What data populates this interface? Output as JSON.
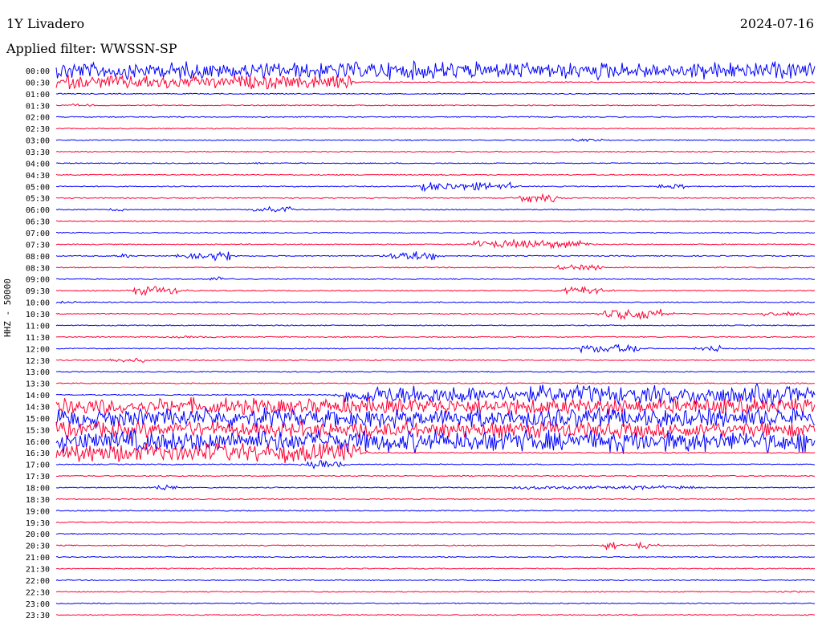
{
  "header": {
    "station": "1Y Livadero",
    "date": "2024-07-16",
    "filter": "Applied filter: WWSSN-SP"
  },
  "chart_data": {
    "type": "line",
    "title": "1Y Livadero",
    "ylabel": "HHZ - 50000",
    "xlabel": "",
    "colors": [
      "#0000ff",
      "#ff0033"
    ],
    "rows": [
      {
        "time": "00:00",
        "activity": [
          [
            0.0,
            1.0,
            0.9
          ]
        ],
        "amp": 14
      },
      {
        "time": "00:30",
        "activity": [
          [
            0.0,
            0.39,
            1.0
          ]
        ],
        "amp": 10
      },
      {
        "time": "01:00",
        "activity": [
          [
            0.78,
            0.81,
            0.5
          ]
        ],
        "amp": 2
      },
      {
        "time": "01:30",
        "activity": [
          [
            0.02,
            0.05,
            1.0
          ]
        ],
        "amp": 2
      },
      {
        "time": "02:00",
        "activity": [],
        "amp": 1
      },
      {
        "time": "02:30",
        "activity": [],
        "amp": 1
      },
      {
        "time": "03:00",
        "activity": [
          [
            0.68,
            0.72,
            1.0
          ]
        ],
        "amp": 2
      },
      {
        "time": "03:30",
        "activity": [],
        "amp": 1
      },
      {
        "time": "04:00",
        "activity": [
          [
            0.24,
            0.27,
            0.6
          ]
        ],
        "amp": 2
      },
      {
        "time": "04:30",
        "activity": [
          [
            0.46,
            0.48,
            0.5
          ]
        ],
        "amp": 2
      },
      {
        "time": "05:00",
        "activity": [
          [
            0.48,
            0.6,
            1.0
          ],
          [
            0.79,
            0.83,
            0.6
          ]
        ],
        "amp": 6
      },
      {
        "time": "05:30",
        "activity": [
          [
            0.61,
            0.66,
            1.0
          ]
        ],
        "amp": 6
      },
      {
        "time": "06:00",
        "activity": [
          [
            0.07,
            0.09,
            0.6
          ],
          [
            0.26,
            0.31,
            1.0
          ]
        ],
        "amp": 4
      },
      {
        "time": "06:30",
        "activity": [],
        "amp": 1
      },
      {
        "time": "07:00",
        "activity": [],
        "amp": 1
      },
      {
        "time": "07:30",
        "activity": [
          [
            0.55,
            0.7,
            1.0
          ]
        ],
        "amp": 6
      },
      {
        "time": "08:00",
        "activity": [
          [
            0.08,
            0.1,
            0.5
          ],
          [
            0.17,
            0.23,
            1.0
          ],
          [
            0.44,
            0.5,
            1.0
          ]
        ],
        "amp": 7
      },
      {
        "time": "08:30",
        "activity": [
          [
            0.66,
            0.72,
            1.0
          ]
        ],
        "amp": 4
      },
      {
        "time": "09:00",
        "activity": [
          [
            0.2,
            0.22,
            1.0
          ]
        ],
        "amp": 4
      },
      {
        "time": "09:30",
        "activity": [
          [
            0.1,
            0.16,
            1.0
          ],
          [
            0.67,
            0.72,
            1.0
          ]
        ],
        "amp": 6
      },
      {
        "time": "10:00",
        "activity": [
          [
            0.0,
            0.03,
            0.6
          ]
        ],
        "amp": 3
      },
      {
        "time": "10:30",
        "activity": [
          [
            0.72,
            0.8,
            1.0
          ],
          [
            0.93,
            0.99,
            0.4
          ]
        ],
        "amp": 8
      },
      {
        "time": "11:00",
        "activity": [
          [
            0.79,
            0.82,
            0.4
          ]
        ],
        "amp": 2
      },
      {
        "time": "11:30",
        "activity": [
          [
            0.15,
            0.23,
            0.5
          ]
        ],
        "amp": 3
      },
      {
        "time": "12:00",
        "activity": [
          [
            0.69,
            0.77,
            1.0
          ],
          [
            0.85,
            0.88,
            1.0
          ]
        ],
        "amp": 6
      },
      {
        "time": "12:30",
        "activity": [
          [
            0.07,
            0.12,
            0.8
          ]
        ],
        "amp": 4
      },
      {
        "time": "13:00",
        "activity": [],
        "amp": 1
      },
      {
        "time": "13:30",
        "activity": [],
        "amp": 1
      },
      {
        "time": "14:00",
        "activity": [
          [
            0.38,
            1.0,
            1.0
          ]
        ],
        "amp": 14
      },
      {
        "time": "14:30",
        "activity": [
          [
            0.0,
            1.0,
            1.0
          ]
        ],
        "amp": 12
      },
      {
        "time": "15:00",
        "activity": [
          [
            0.0,
            1.0,
            1.0
          ]
        ],
        "amp": 14
      },
      {
        "time": "15:30",
        "activity": [
          [
            0.0,
            1.0,
            1.0
          ]
        ],
        "amp": 12
      },
      {
        "time": "16:00",
        "activity": [
          [
            0.0,
            1.0,
            1.0
          ]
        ],
        "amp": 16
      },
      {
        "time": "16:30",
        "activity": [
          [
            0.0,
            0.4,
            1.0
          ]
        ],
        "amp": 14
      },
      {
        "time": "17:00",
        "activity": [
          [
            0.33,
            0.38,
            0.9
          ]
        ],
        "amp": 6
      },
      {
        "time": "17:30",
        "activity": [
          [
            0.53,
            0.55,
            0.5
          ]
        ],
        "amp": 2
      },
      {
        "time": "18:00",
        "activity": [
          [
            0.13,
            0.16,
            1.0
          ],
          [
            0.6,
            0.85,
            0.5
          ]
        ],
        "amp": 5
      },
      {
        "time": "18:30",
        "activity": [],
        "amp": 1
      },
      {
        "time": "19:00",
        "activity": [
          [
            0.29,
            0.31,
            0.5
          ]
        ],
        "amp": 2
      },
      {
        "time": "19:30",
        "activity": [],
        "amp": 1
      },
      {
        "time": "20:00",
        "activity": [],
        "amp": 1
      },
      {
        "time": "20:30",
        "activity": [
          [
            0.72,
            0.74,
            1.0
          ],
          [
            0.76,
            0.78,
            1.0
          ]
        ],
        "amp": 6
      },
      {
        "time": "21:00",
        "activity": [],
        "amp": 1
      },
      {
        "time": "21:30",
        "activity": [],
        "amp": 1
      },
      {
        "time": "22:00",
        "activity": [],
        "amp": 1
      },
      {
        "time": "22:30",
        "activity": [
          [
            0.94,
            0.99,
            0.6
          ]
        ],
        "amp": 2
      },
      {
        "time": "23:00",
        "activity": [
          [
            0.07,
            0.09,
            0.4
          ]
        ],
        "amp": 1
      },
      {
        "time": "23:30",
        "activity": [],
        "amp": 1
      }
    ]
  }
}
